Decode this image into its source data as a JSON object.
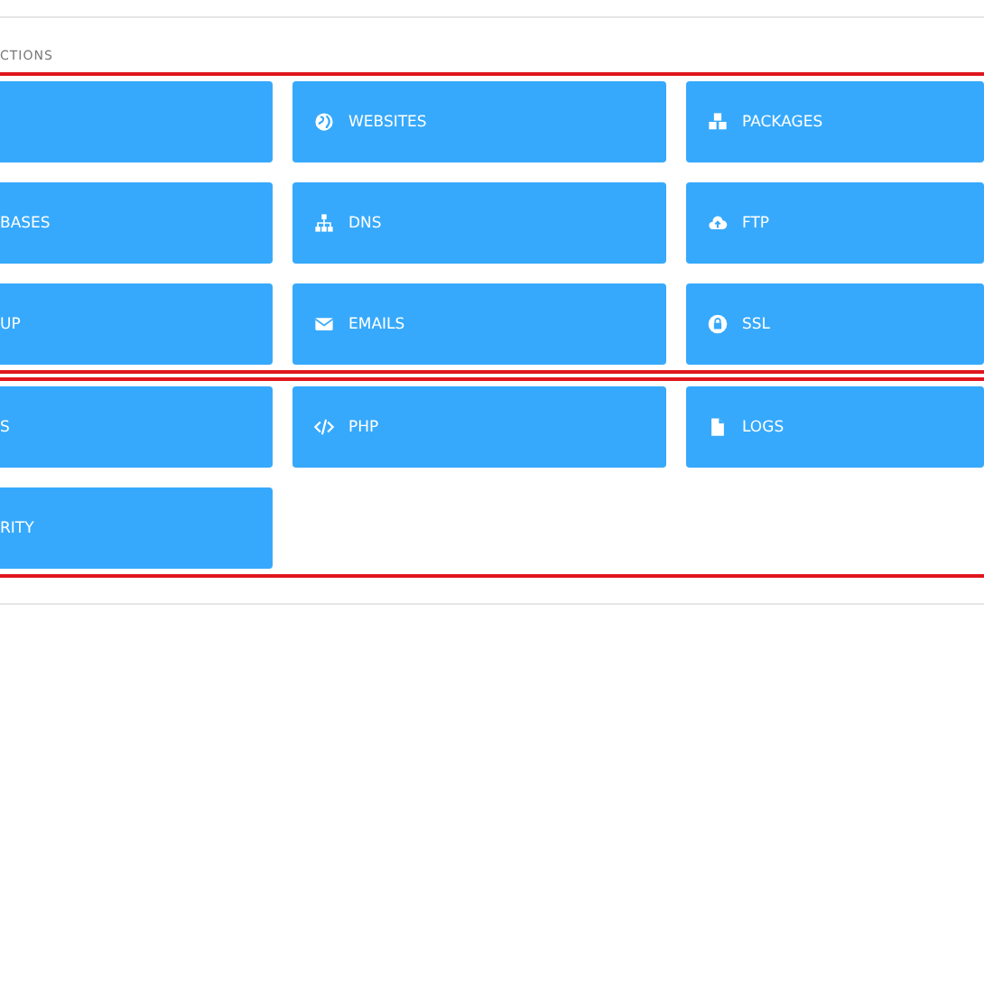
{
  "heading": "CTIONS",
  "groups": [
    {
      "buttons": [
        {
          "kind": "cut"
        },
        {
          "kind": "full",
          "label": "WEBSITES"
        },
        {
          "kind": "full",
          "label": "PACKAGES"
        },
        {
          "kind": "cut",
          "label": "BASES"
        },
        {
          "kind": "full",
          "label": "DNS"
        },
        {
          "kind": "full",
          "label": "FTP"
        },
        {
          "kind": "cut",
          "label": "UP"
        },
        {
          "kind": "full",
          "label": "EMAILS"
        },
        {
          "kind": "full",
          "label": "SSL"
        }
      ]
    },
    {
      "buttons": [
        {
          "kind": "cut",
          "label": "S"
        },
        {
          "kind": "full",
          "label": "PHP"
        },
        {
          "kind": "full",
          "label": "LOGS"
        },
        {
          "kind": "cut",
          "label": "RITY"
        }
      ]
    }
  ]
}
